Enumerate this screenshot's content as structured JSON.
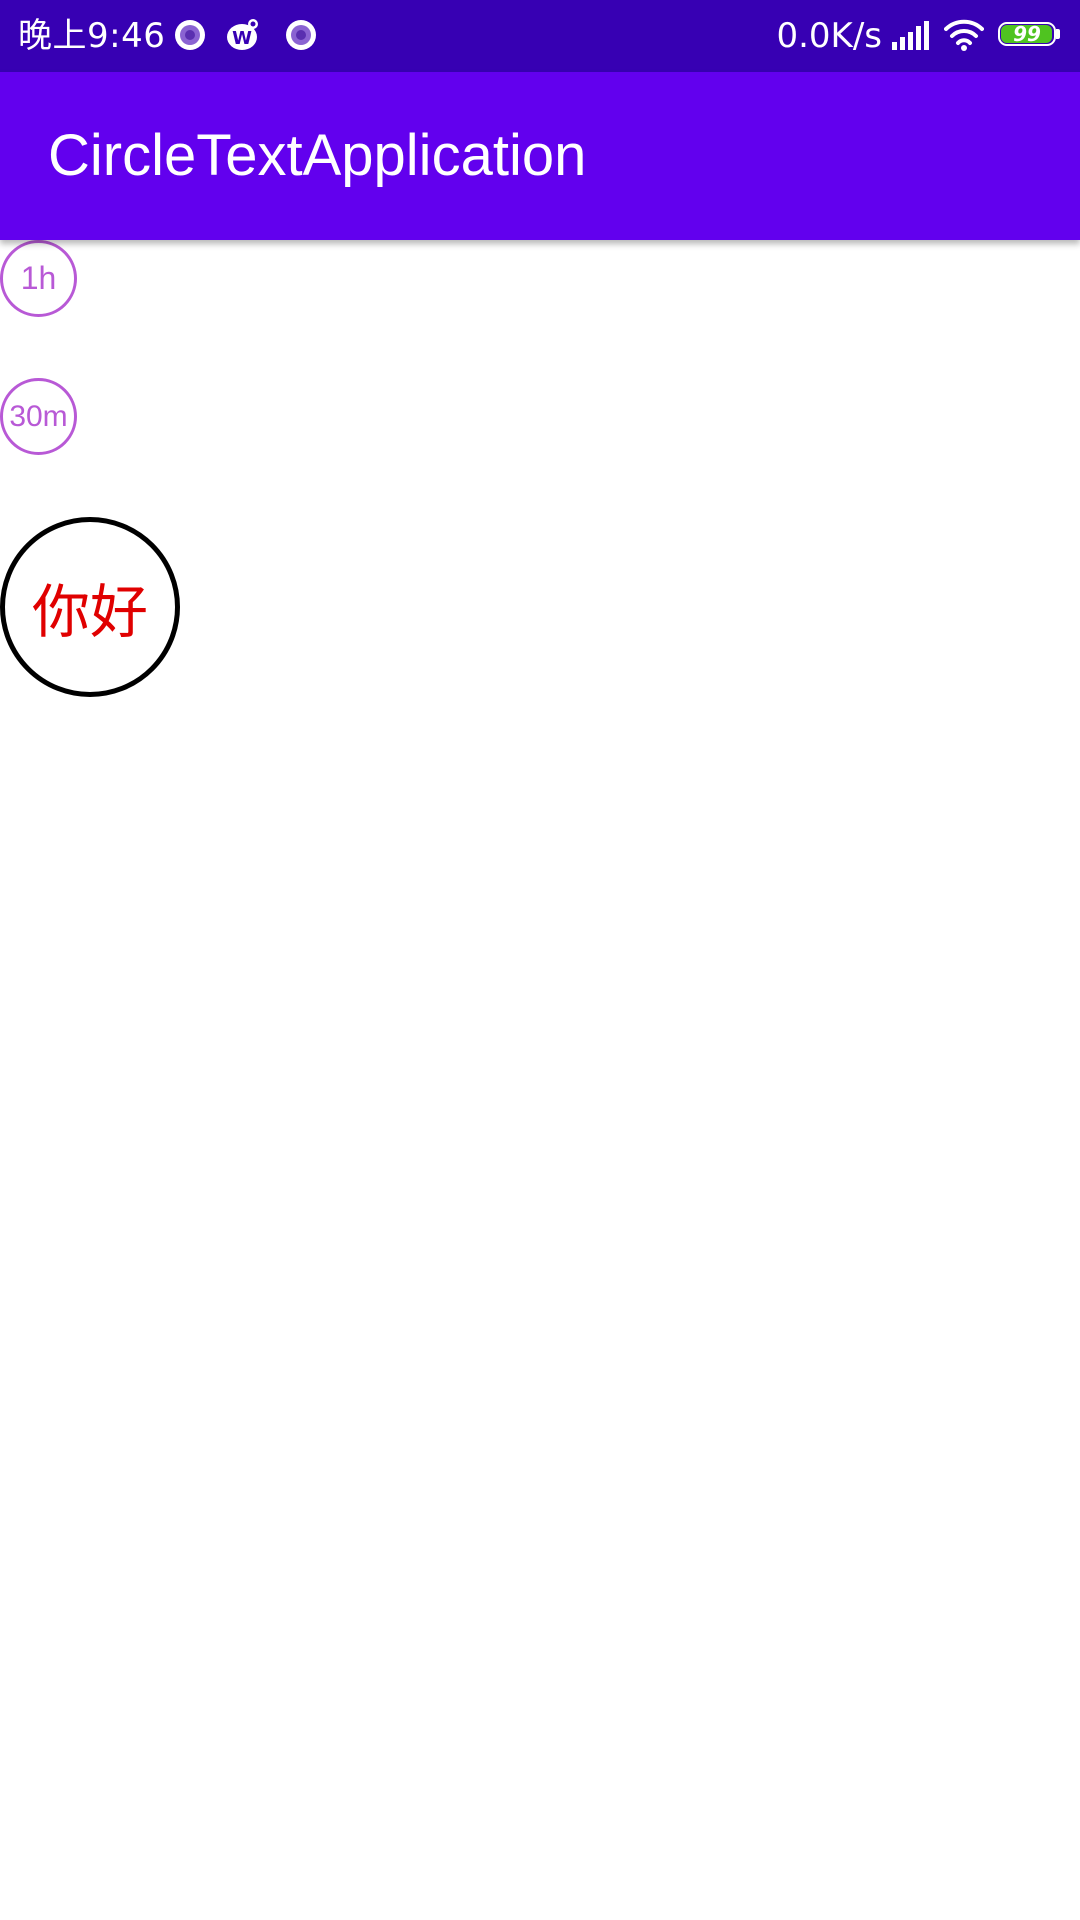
{
  "status_bar": {
    "time": "晚上9:46",
    "network_speed": "0.0K/s",
    "battery_level": "99",
    "icons": [
      "notification-app-icon",
      "weibo-icon",
      "notification-app-icon",
      "signal-icon",
      "wifi-icon",
      "battery-icon"
    ],
    "colors": {
      "background": "#3700b3",
      "battery_fill": "#4fc320"
    }
  },
  "app_bar": {
    "title": "CircleTextApplication",
    "background": "#6200ee"
  },
  "main": {
    "circles": [
      {
        "label": "1h",
        "color": "#b859d6"
      },
      {
        "label": "30m",
        "color": "#b859d6"
      },
      {
        "label": "你好",
        "color": "#e00000",
        "border_color": "#000000"
      }
    ]
  }
}
